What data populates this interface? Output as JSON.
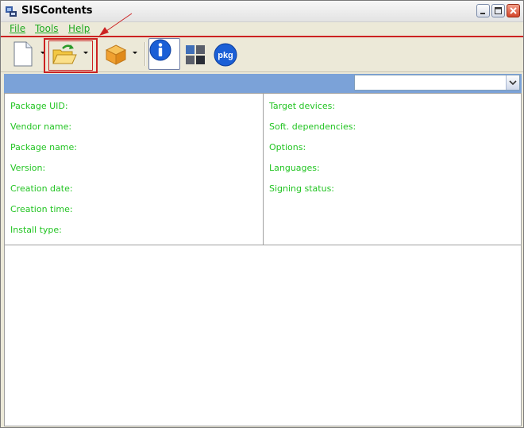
{
  "window": {
    "title": "SISContents"
  },
  "menu": [
    {
      "label": "File"
    },
    {
      "label": "Tools"
    },
    {
      "label": "Help"
    }
  ],
  "toolbar": {
    "icons": [
      "new-file-icon",
      "open-folder-icon",
      "package-icon",
      "info-icon",
      "windows-icon",
      "pkg-icon"
    ],
    "pkg_label": "pkg"
  },
  "combo": {
    "value": ""
  },
  "left_fields": [
    "Package UID:",
    "Vendor name:",
    "Package name:",
    "Version:",
    "Creation date:",
    "Creation time:",
    "Install type:"
  ],
  "right_fields": [
    "Target devices:",
    "Soft. dependencies:",
    "Options:",
    "Languages:",
    "Signing status:"
  ],
  "colors": {
    "field_text": "#22c422",
    "menu_text": "#22aa22",
    "highlight": "#cc2222",
    "blue_bar": "#7ba2d8"
  }
}
